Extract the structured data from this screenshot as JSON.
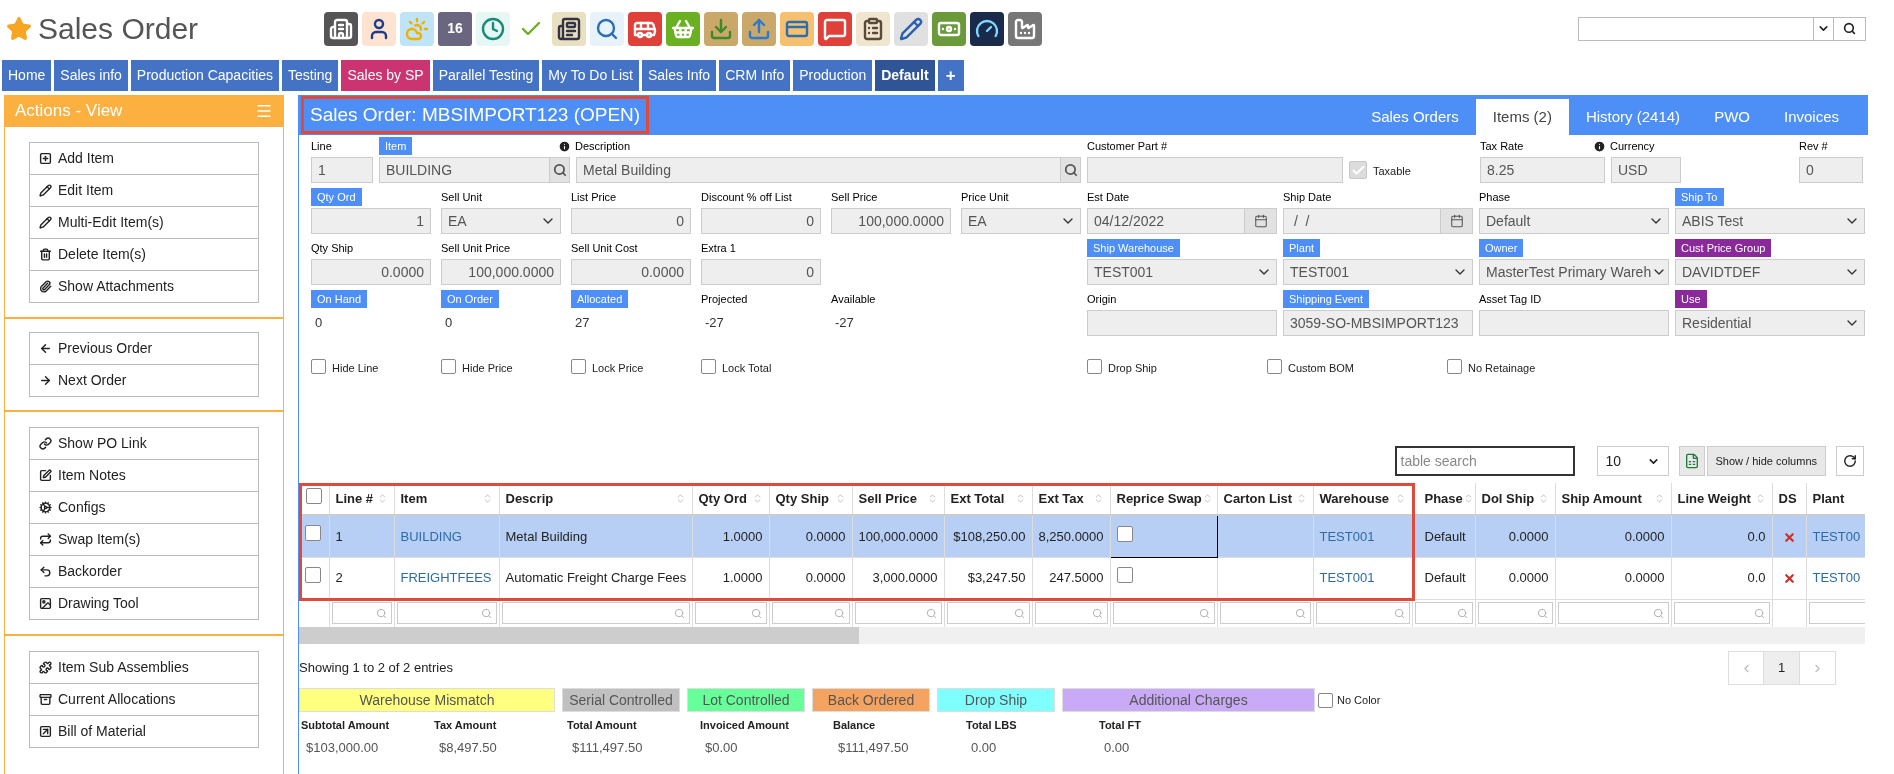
{
  "header": {
    "title": "Sales Order",
    "calendar_day": "16"
  },
  "nav_tabs": [
    {
      "label": "Home",
      "selected": false,
      "color": "#4472c4"
    },
    {
      "label": "Sales info",
      "selected": false,
      "color": "#4472c4"
    },
    {
      "label": "Production Capacities",
      "selected": false,
      "color": "#4472c4"
    },
    {
      "label": "Testing",
      "selected": false,
      "color": "#4472c4"
    },
    {
      "label": "Sales by SP",
      "selected": false,
      "color": "#cc3371"
    },
    {
      "label": "Parallel Testing",
      "selected": false,
      "color": "#4472c4"
    },
    {
      "label": "My To Do List",
      "selected": false,
      "color": "#4472c4"
    },
    {
      "label": "Sales Info",
      "selected": false,
      "color": "#4472c4"
    },
    {
      "label": "CRM Info",
      "selected": false,
      "color": "#4472c4"
    },
    {
      "label": "Production",
      "selected": false,
      "color": "#4472c4"
    },
    {
      "label": "Default",
      "selected": true,
      "color": "#2f5597"
    }
  ],
  "nav_add": "+",
  "sidebar": {
    "title": "Actions - View",
    "groups": [
      {
        "items": [
          {
            "label": "Add Item"
          },
          {
            "label": "Edit Item"
          },
          {
            "label": "Multi-Edit Item(s)"
          },
          {
            "label": "Delete Item(s)"
          },
          {
            "label": "Show Attachments"
          }
        ]
      },
      {
        "items": [
          {
            "label": "Previous Order"
          },
          {
            "label": "Next Order"
          }
        ]
      },
      {
        "items": [
          {
            "label": "Show PO Link"
          },
          {
            "label": "Item Notes"
          },
          {
            "label": "Configs"
          },
          {
            "label": "Swap Item(s)"
          },
          {
            "label": "Backorder"
          },
          {
            "label": "Drawing Tool"
          }
        ]
      },
      {
        "items": [
          {
            "label": "Item Sub Assemblies"
          },
          {
            "label": "Current Allocations"
          },
          {
            "label": "Bill of Material"
          }
        ]
      }
    ]
  },
  "order": {
    "title": "Sales Order: MBSIMPORT123 (OPEN)",
    "tabs": [
      {
        "label": "Sales Orders",
        "selected": false
      },
      {
        "label": "Items (2)",
        "selected": true
      },
      {
        "label": "History (2414)",
        "selected": false
      },
      {
        "label": "PWO",
        "selected": false
      },
      {
        "label": "Invoices",
        "selected": false
      }
    ]
  },
  "form": {
    "left_rows": [
      [
        {
          "label": "Line",
          "kind": "text",
          "value": "1"
        },
        {
          "label": "Item",
          "color": "#4d8ff6",
          "kind": "search",
          "value": "BUILDING"
        },
        {
          "label": "Description",
          "kind": "search",
          "value": "Metal Building",
          "info": true
        }
      ],
      [
        {
          "label": "Qty Ord",
          "color": "#4d8ff6",
          "kind": "number",
          "value": "1"
        },
        {
          "label": "Sell Unit",
          "kind": "select",
          "value": "EA"
        },
        {
          "label": "List Price",
          "kind": "number",
          "value": "0"
        },
        {
          "label": "Discount % off List",
          "kind": "number",
          "value": "0"
        },
        {
          "label": "Sell Price",
          "kind": "number",
          "value": "100,000.0000"
        },
        {
          "label": "Price Unit",
          "kind": "select",
          "value": "EA"
        }
      ],
      [
        {
          "label": "Qty Ship",
          "kind": "number",
          "value": "0.0000"
        },
        {
          "label": "Sell Unit Price",
          "kind": "number",
          "value": "100,000.0000"
        },
        {
          "label": "Sell Unit Cost",
          "kind": "number",
          "value": "0.0000"
        },
        {
          "label": "Extra 1",
          "kind": "number",
          "value": "0"
        }
      ],
      [
        {
          "label": "On Hand",
          "color": "#4d8ff6",
          "kind": "readout",
          "value": "0"
        },
        {
          "label": "On Order",
          "color": "#4d8ff6",
          "kind": "readout",
          "value": "0"
        },
        {
          "label": "Allocated",
          "color": "#4d8ff6",
          "kind": "readout",
          "value": "27"
        },
        {
          "label": "Projected",
          "kind": "readout",
          "value": "-27"
        },
        {
          "label": "Available",
          "kind": "readout",
          "value": "-27"
        }
      ]
    ],
    "left_checkboxes": [
      {
        "label": "Hide Line",
        "checked": false
      },
      {
        "label": "Hide Price",
        "checked": false
      },
      {
        "label": "Lock Price",
        "checked": false
      },
      {
        "label": "Lock Total",
        "checked": false
      }
    ],
    "right_rows": [
      [
        {
          "label": "Customer Part #",
          "kind": "text"
        },
        {
          "label": "Taxable",
          "kind": "checkbox",
          "checked": true,
          "disabled": true
        },
        {
          "label": "Tax Rate",
          "kind": "text",
          "value": "8.25"
        },
        {
          "label": "Currency",
          "kind": "text",
          "value": "USD",
          "info": true
        },
        {
          "label": "Rev #",
          "kind": "text",
          "value": "0"
        }
      ],
      [
        {
          "label": "Est Date",
          "kind": "date",
          "value": "04/12/2022"
        },
        {
          "label": "Ship Date",
          "kind": "date",
          "value": " /  /"
        },
        {
          "label": "Phase",
          "kind": "select",
          "value": "Default"
        },
        {
          "label": "Ship To",
          "color": "#4d8ff6",
          "kind": "select",
          "value": "ABIS Test"
        }
      ],
      [
        {
          "label": "Ship Warehouse",
          "color": "#4d8ff6",
          "kind": "select",
          "value": "TEST001"
        },
        {
          "label": "Plant",
          "color": "#4d8ff6",
          "kind": "select",
          "value": "TEST001"
        },
        {
          "label": "Owner",
          "color": "#4d8ff6",
          "kind": "select",
          "value": "MasterTest Primary Wareh"
        },
        {
          "label": "Cust Price Group",
          "color": "#8a2a9a",
          "kind": "select",
          "value": "DAVIDTDEF"
        }
      ],
      [
        {
          "label": "Origin",
          "kind": "text"
        },
        {
          "label": "Shipping Event",
          "color": "#4d8ff6",
          "kind": "text",
          "value": "3059-SO-MBSIMPORT123"
        },
        {
          "label": "Asset Tag ID",
          "kind": "text"
        },
        {
          "label": "Use",
          "color": "#8a2a9a",
          "kind": "select",
          "value": "Residential"
        }
      ]
    ],
    "right_checkboxes": [
      {
        "label": "Drop Ship",
        "checked": false
      },
      {
        "label": "Custom BOM",
        "checked": false
      },
      {
        "label": "No Retainage",
        "checked": false
      }
    ]
  },
  "table_tools": {
    "search_placeholder": "table search",
    "page_size": "10",
    "columns_button": "Show / hide columns"
  },
  "table": {
    "all_checked": false,
    "columns": [
      {
        "label": "Line #",
        "kind": "text",
        "sortable": true
      },
      {
        "label": "Item",
        "kind": "link",
        "sortable": true
      },
      {
        "label": "Descrip",
        "kind": "text",
        "sortable": true
      },
      {
        "label": "Qty Ord",
        "kind": "number",
        "sortable": true
      },
      {
        "label": "Qty Ship",
        "kind": "number",
        "sortable": true
      },
      {
        "label": "Sell Price",
        "kind": "number",
        "sortable": true
      },
      {
        "label": "Ext Total",
        "kind": "number",
        "sortable": true
      },
      {
        "label": "Ext Tax",
        "kind": "number",
        "sortable": true
      },
      {
        "label": "Reprice Swap",
        "kind": "checkbox",
        "sortable": true
      },
      {
        "label": "Carton List",
        "kind": "text",
        "sortable": true
      },
      {
        "label": "Warehouse",
        "kind": "link",
        "sortable": true
      },
      {
        "label": "Phase",
        "kind": "text",
        "sortable": true
      },
      {
        "label": "Dol Ship",
        "kind": "number",
        "sortable": true
      },
      {
        "label": "Ship Amount",
        "kind": "number",
        "sortable": true
      },
      {
        "label": "Line Weight",
        "kind": "number",
        "sortable": true
      },
      {
        "label": "DS",
        "kind": "flag",
        "sortable": false
      },
      {
        "label": "Plant",
        "kind": "link",
        "sortable": false
      }
    ],
    "rows": [
      {
        "selected": true,
        "checked": false,
        "cells": [
          "1",
          "BUILDING",
          "Metal Building",
          "1.0000",
          "0.0000",
          "100,000.0000",
          "$108,250.00",
          "8,250.0000",
          false,
          null,
          "TEST001",
          "Default",
          "0.0000",
          "0.0000",
          "0.0",
          false,
          "TEST00"
        ]
      },
      {
        "selected": false,
        "checked": false,
        "cells": [
          "2",
          "FREIGHTFEES",
          "Automatic Freight Charge Fees",
          "1.0000",
          "0.0000",
          "3,000.0000",
          "$3,247.50",
          "247.5000",
          false,
          null,
          "TEST001",
          "Default",
          "0.0000",
          "0.0000",
          "0.0",
          false,
          "TEST00"
        ]
      }
    ]
  },
  "summary": "Showing 1 to 2 of 2 entries",
  "pagination": {
    "page": "1"
  },
  "legend": [
    {
      "label": "Warehouse Mismatch",
      "color": "#ffff80"
    },
    {
      "label": "Serial Controlled",
      "color": "#c0c0c0"
    },
    {
      "label": "Lot Controlled",
      "color": "#66ff99"
    },
    {
      "label": "Back Ordered",
      "color": "#f4a460"
    },
    {
      "label": "Drop Ship",
      "color": "#80ffff"
    },
    {
      "label": "Additional Charges",
      "color": "#c9aaf7"
    }
  ],
  "no_color": {
    "label": "No Color",
    "checked": false
  },
  "totals": [
    {
      "label": "Subtotal Amount",
      "value": "$103,000.00"
    },
    {
      "label": "Tax Amount",
      "value": "$8,497.50"
    },
    {
      "label": "Total Amount",
      "value": "$111,497.50"
    },
    {
      "label": "Invoiced Amount",
      "value": "$0.00"
    },
    {
      "label": "Balance",
      "value": "$111,497.50"
    },
    {
      "label": "Total LBS",
      "value": "0.00"
    },
    {
      "label": "Total FT",
      "value": "0.00"
    }
  ]
}
